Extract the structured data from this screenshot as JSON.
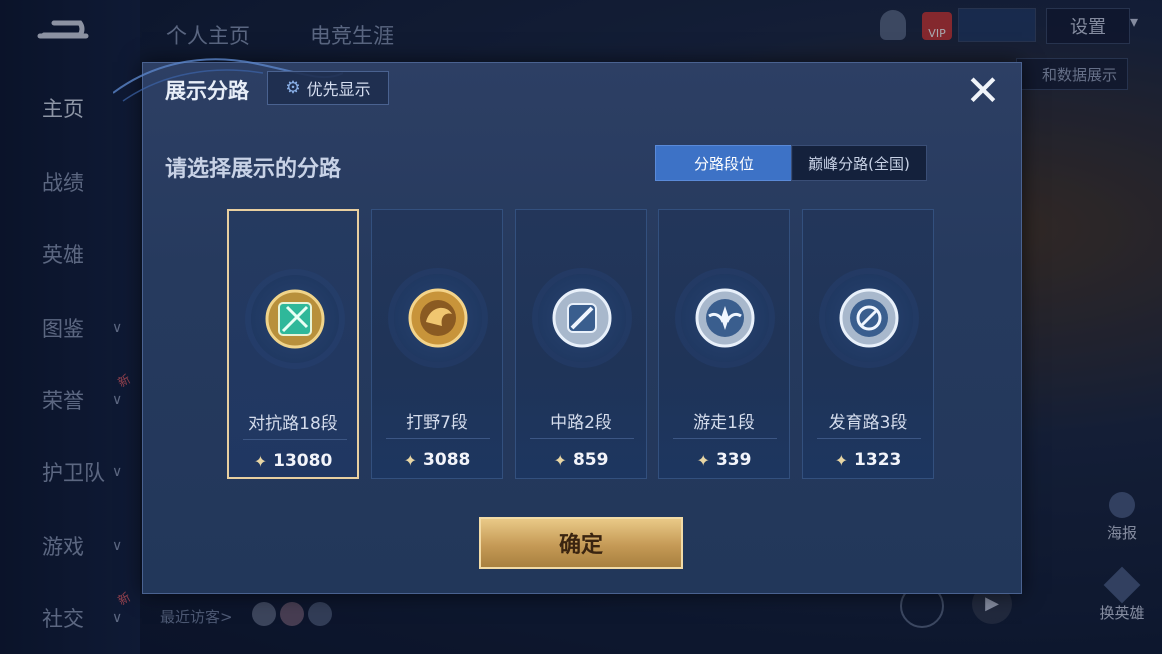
{
  "top_tabs": [
    "个人主页",
    "电竞生涯"
  ],
  "settings_label": "设置",
  "right_bar_text": "和数据展示",
  "sidebar": {
    "items": [
      {
        "label": "主页",
        "active": true,
        "chevron": false,
        "new": false
      },
      {
        "label": "战绩",
        "active": false,
        "chevron": false,
        "new": false
      },
      {
        "label": "英雄",
        "active": false,
        "chevron": false,
        "new": false
      },
      {
        "label": "图鉴",
        "active": false,
        "chevron": true,
        "new": false
      },
      {
        "label": "荣誉",
        "active": false,
        "chevron": true,
        "new": true
      },
      {
        "label": "护卫队",
        "active": false,
        "chevron": true,
        "new": false
      },
      {
        "label": "游戏",
        "active": false,
        "chevron": true,
        "new": false
      },
      {
        "label": "社交",
        "active": false,
        "chevron": true,
        "new": true
      }
    ],
    "new_badge": "新"
  },
  "visitors_label": "最近访客>",
  "vip_label": "VIP",
  "right_icons": {
    "poster": "海报",
    "change_hero": "换英雄"
  },
  "modal": {
    "title": "展示分路",
    "priority_button": "优先显示",
    "close_icon": "✕",
    "subtitle": "请选择展示的分路",
    "segments": {
      "active": "分路段位",
      "inactive": "巅峰分路(全国)"
    },
    "lanes": [
      {
        "name": "对抗路18段",
        "score": "13080",
        "selected": true,
        "medal": "green-shield-medal-icon"
      },
      {
        "name": "打野7段",
        "score": "3088",
        "selected": false,
        "medal": "gold-dragon-medal-icon"
      },
      {
        "name": "中路2段",
        "score": "859",
        "selected": false,
        "medal": "silver-slash-medal-icon"
      },
      {
        "name": "游走1段",
        "score": "339",
        "selected": false,
        "medal": "silver-wings-medal-icon"
      },
      {
        "name": "发育路3段",
        "score": "1323",
        "selected": false,
        "medal": "silver-circle-medal-icon"
      }
    ],
    "confirm_button": "确定"
  },
  "colors": {
    "accent_blue": "#3d72c6",
    "gold": "#e8cfa0",
    "modal_bg": "#263a5e"
  }
}
